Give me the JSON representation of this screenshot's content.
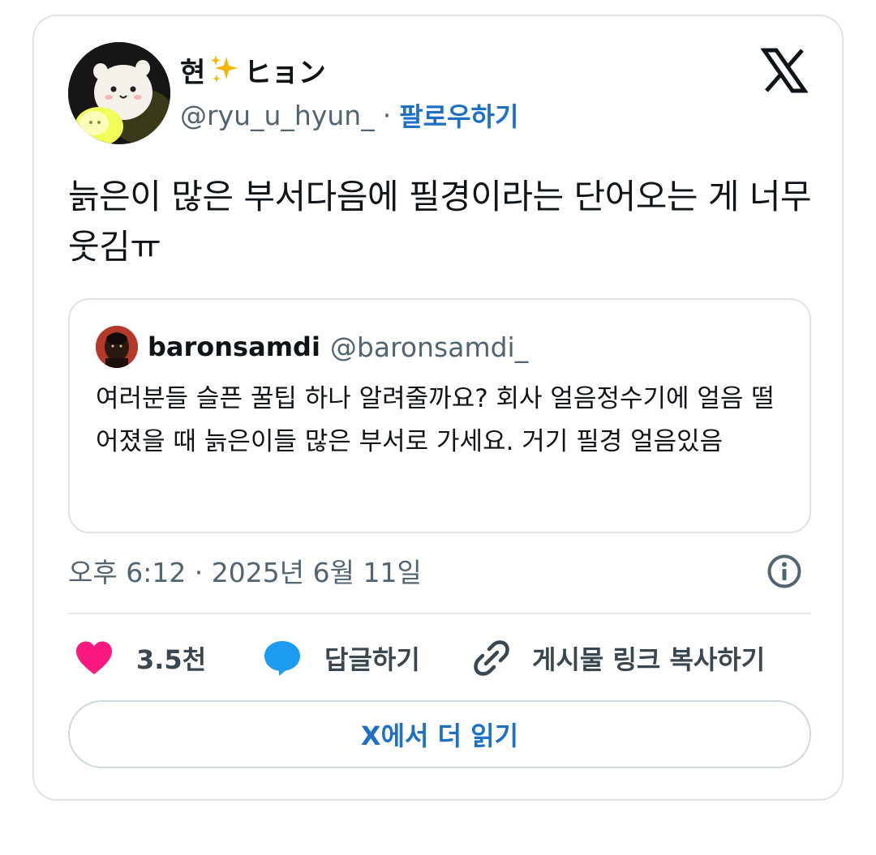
{
  "author": {
    "display_name_prefix": "현",
    "display_name_suffix": "ヒョン",
    "handle": "@ryu_u_hyun_",
    "separator": "·",
    "follow_label": "팔로우하기"
  },
  "tweet": {
    "text": "늙은이 많은 부서다음에 필경이라는 단어오는 게 너무웃김ㅠ"
  },
  "quoted_tweet": {
    "name": "baronsamdi",
    "handle": "@baronsamdi_",
    "text": "여러분들 슬픈 꿀팁 하나 알려줄까요? 회사 얼음정수기에 얼음 떨어졌을 때 늙은이들 많은 부서로 가세요. 거기 필경 얼음있음"
  },
  "meta": {
    "timestamp": "오후 6:12 · 2025년 6월 11일"
  },
  "actions": {
    "like_count": "3.5천",
    "reply_label": "답글하기",
    "copy_link_label": "게시물 링크 복사하기"
  },
  "read_more_label": "X에서 더 읽기",
  "colors": {
    "link_blue": "#1d70c6",
    "heart_pink": "#f91880",
    "reply_blue": "#1d9bf0",
    "muted_gray": "#536471",
    "border": "#dfe3e6"
  },
  "icons": {
    "name_emoji": "sparkles-icon",
    "platform_logo": "x-logo-icon",
    "info": "info-icon",
    "like": "heart-icon",
    "reply": "speech-bubble-icon",
    "copy_link": "link-icon"
  }
}
